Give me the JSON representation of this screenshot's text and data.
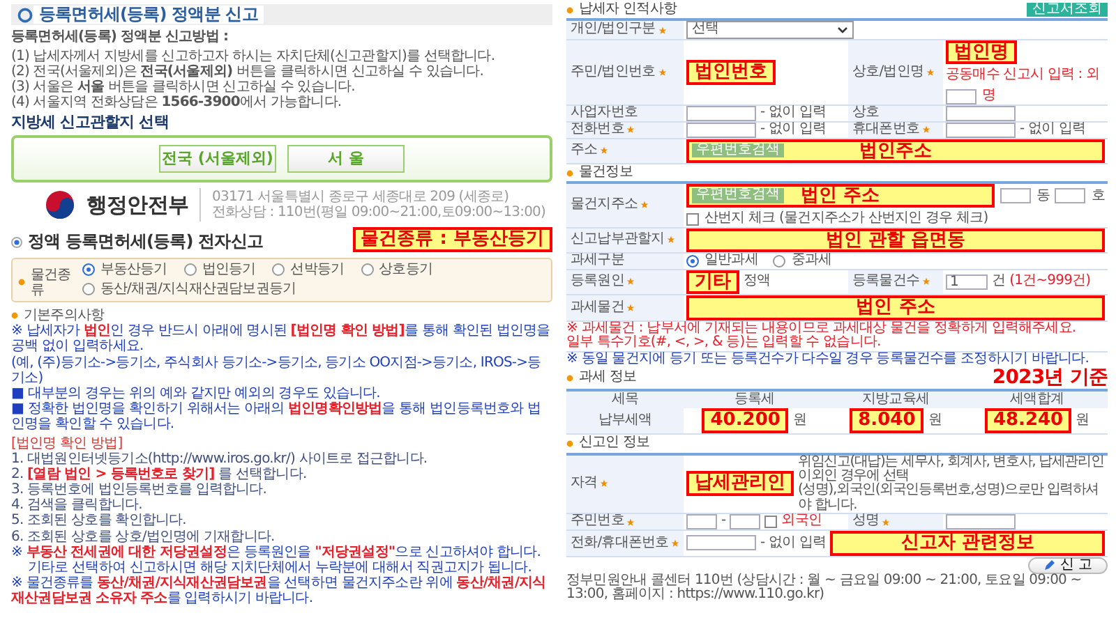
{
  "left": {
    "title": "등록면허세(등록) 정액분 신고",
    "method_heading": "등록면허세(등록) 정액분 신고방법 :",
    "method_steps": [
      "(1) 납세자께서 지방세를 신고하고자 하시는 자치단체(신고관할지)를 선택합니다.",
      "(2) 전국(서울제외)은 **전국(서울제외)** 버튼을 클릭하시면 신고하실 수 있습니다.",
      "(3) 서울은 **서울** 버튼을 클릭하시면 신고하실 수 있습니다.",
      "(4) 서울지역 전화상담은 **1566-3900**에서 가능합니다."
    ],
    "select_heading": "지방세 신고관할지 선택",
    "region_buttons": [
      "전국 (서울제외)",
      "서 울"
    ],
    "ministry": {
      "name": "행정안전부",
      "address": "03171 서울특별시 종로구 세종대로 209 (세종로)",
      "phone": "전화상담 : 110번(평일 09:00~21:00,토09:00~13:00)"
    },
    "annotation": "물건종류 : 부동산등기",
    "form_title": "정액 등록면허세(등록) 전자신고",
    "item_type": {
      "label": "물건종류",
      "options": [
        {
          "label": "부동산등기",
          "selected": true
        },
        {
          "label": "법인등기",
          "selected": false
        },
        {
          "label": "선박등기",
          "selected": false
        },
        {
          "label": "상호등기",
          "selected": false
        },
        {
          "label": "동산/채권/지식재산권담보권등기",
          "selected": false
        }
      ]
    },
    "notice_heading": "기본주의사항",
    "notes": [
      {
        "kind": "note",
        "segments": [
          {
            "text": "※ 납세자가 ",
            "highlight": false
          },
          {
            "text": "법인",
            "highlight": true
          },
          {
            "text": "인 경우 반드시 아래에 명시된 ",
            "highlight": false
          },
          {
            "text": "[법인명 확인 방법]",
            "highlight": true
          },
          {
            "text": "를 통해 확인된 법인명을 공백 없이 입력하세요.",
            "highlight": false
          }
        ]
      },
      {
        "kind": "note",
        "segments": [
          {
            "text": "(예, (주)등기소->등기소, 주식회사 등기소->등기소, 등기소 OO지점->등기소, IROS->등기소)",
            "highlight": false
          }
        ]
      },
      {
        "kind": "note",
        "segments": [
          {
            "text": "■ 대부분의 경우는 위의 예와 같지만 예외의 경우도 있습니다.",
            "highlight": false
          }
        ]
      },
      {
        "kind": "note",
        "segments": [
          {
            "text": "■ 정확한 법인명을 확인하기 위해서는 아래의 ",
            "highlight": false
          },
          {
            "text": "법인명확인방법",
            "highlight": true
          },
          {
            "text": "을 통해 법인등록번호와 법인명을 확인할 수 있습니다.",
            "highlight": false
          }
        ]
      },
      {
        "kind": "title",
        "segments": [
          {
            "text": "[법인명 확인 방법]",
            "highlight": false
          }
        ]
      },
      {
        "kind": "step",
        "segments": [
          {
            "text": "1. 대법원인터넷등기소(http://www.iros.go.kr/) 사이트로 접근합니다.",
            "highlight": false
          }
        ]
      },
      {
        "kind": "step",
        "segments": [
          {
            "text": "2. ",
            "highlight": false
          },
          {
            "text": "[열람 법인 > 등록번호로 찾기]",
            "highlight": true
          },
          {
            "text": " 를 선택합니다.",
            "highlight": false
          }
        ]
      },
      {
        "kind": "step",
        "segments": [
          {
            "text": "3. 등록번호에 법인등록번호를 입력합니다.",
            "highlight": false
          }
        ]
      },
      {
        "kind": "step",
        "segments": [
          {
            "text": "4. 검색을 클릭합니다.",
            "highlight": false
          }
        ]
      },
      {
        "kind": "step",
        "segments": [
          {
            "text": "5. 조회된 상호를 확인합니다.",
            "highlight": false
          }
        ]
      },
      {
        "kind": "step",
        "segments": [
          {
            "text": "6. 조회된 상호를 상호/법인명에 기재합니다.",
            "highlight": false
          }
        ]
      },
      {
        "kind": "note",
        "segments": [
          {
            "text": "※ ",
            "highlight": false
          },
          {
            "text": "부동산 전세권에 대한 저당권설정",
            "highlight": true
          },
          {
            "text": "은 등록원인을 ",
            "highlight": false
          },
          {
            "text": "\"저당권설정\"",
            "highlight": true
          },
          {
            "text": "으로 신고하셔야 합니다.",
            "highlight": false
          }
        ]
      },
      {
        "kind": "indent",
        "segments": [
          {
            "text": "기타로 선택하여 신고하시면 해당 지치단체에서 누락분에 대해서 직권고지가 됩니다.",
            "highlight": false
          }
        ]
      },
      {
        "kind": "note",
        "segments": [
          {
            "text": "※ 물건종류를 ",
            "highlight": false
          },
          {
            "text": "동산/채권/지식재산권담보권",
            "highlight": true
          },
          {
            "text": "을 선택하면 물건지주소란 위에 ",
            "highlight": false
          },
          {
            "text": "동산/채권/지식재산권담보권 소유자 주소",
            "highlight": true
          },
          {
            "text": "를 입력하시기 바랍니다.",
            "highlight": false
          }
        ]
      }
    ]
  },
  "right": {
    "taxpayer": {
      "heading": "납세자 인적사항",
      "lookup_button": "신고서조회",
      "type": {
        "label": "개인/법인구분",
        "required": true
      },
      "type_select": "선택",
      "id": {
        "label": "주민/법인번호",
        "required": true
      },
      "id_annotation": "법인번호",
      "name": {
        "label": "상호/법인명",
        "required": true
      },
      "name_annotation": "법인명",
      "joint_note": "공동매수 신고시 입력 : 외",
      "joint_unit": "명",
      "biz": {
        "label": "사업자번호",
        "required": false
      },
      "biz_hint": "- 없이 입력",
      "trade": {
        "label": "상호",
        "required": false
      },
      "phone": {
        "label": "전화번호",
        "required": true
      },
      "phone_hint": "- 없이 입력",
      "mobile": {
        "label": "휴대폰번호",
        "required": true
      },
      "mobile_hint": "- 없이 입력",
      "address": {
        "label": "주소",
        "required": true
      },
      "zip_button": "우편번호검색",
      "address_annotation": "법인주소"
    },
    "property": {
      "heading": "물건정보",
      "address": {
        "label": "물건지주소",
        "required": true
      },
      "zip_button": "우편번호검색",
      "address_annotation": "법인 주소",
      "dong": "동",
      "ho": "호",
      "mountain_check": {
        "label": "산번지 체크 (물건지주소가 산번지인 경우 체크)",
        "checked": false
      },
      "jurisdiction": {
        "label": "신고납부관할지",
        "required": true
      },
      "jurisdiction_annotation": "법인 관할 읍면동",
      "tax_class": {
        "label": "과세구분",
        "required": false
      },
      "tax_class_options": [
        {
          "label": "일반과세",
          "selected": true
        },
        {
          "label": "중과세",
          "selected": false
        }
      ],
      "cause": {
        "label": "등록원인",
        "required": true
      },
      "cause_annotation": "기타",
      "cause_text": "정액",
      "count": {
        "label": "등록물건수",
        "required": true
      },
      "count_value": "1",
      "count_unit": "건",
      "count_range": "(1건~999건)",
      "object": {
        "label": "과세물건",
        "required": true
      },
      "object_annotation": "법인 주소",
      "warnings": [
        "※ 과세물건 : 납부서에 기재되는 내용이므로 과세대상 물건을 정확하게 입력해주세요.",
        "일부 특수기호(#, <, >, & 등)는 입력할 수 없습니다."
      ],
      "info": "※ 동일 물건지에 등기 또는 등록건수가 다수일 경우 등록물건수를 조정하시기 바랍니다."
    },
    "tax": {
      "heading": "과세 정보",
      "year_annotation": "2023년 기준",
      "columns": [
        "세목",
        "등록세",
        "지방교육세",
        "세액합계"
      ],
      "row_label": "납부세액",
      "amounts": [
        {
          "value": "40.200",
          "unit": "원"
        },
        {
          "value": "8.040",
          "unit": "원"
        },
        {
          "value": "48.240",
          "unit": "원"
        }
      ]
    },
    "reporter": {
      "heading": "신고인 정보",
      "qualification": {
        "label": "자격",
        "required": true
      },
      "qualification_annotation": "납세관리인",
      "qualification_notes": [
        "위임신고(대납)는 세무사, 회계사, 변호사, 납세관리인 이외인 경우에 선택",
        "(성명),외국인(외국인등록번호,성명)으로만 입력하셔야 합니다."
      ],
      "id": {
        "label": "주민번호",
        "required": true
      },
      "id_separator": "-",
      "foreigner": {
        "label": "외국인",
        "checked": false
      },
      "name": {
        "label": "성명",
        "required": true
      },
      "phone": {
        "label": "전화/휴대폰번호",
        "required": true
      },
      "phone_hint": "- 없이 입력",
      "phone_annotation": "신고자 관련정보"
    },
    "submit_button": "신 고",
    "footer": "정부민원안내 콜센터 110번 (상담시간 : 월 ~ 금요일 09:00 ~ 21:00, 토요일 09:00 ~ 13:00, 홈페이지 : https://www.110.go.kr)"
  }
}
